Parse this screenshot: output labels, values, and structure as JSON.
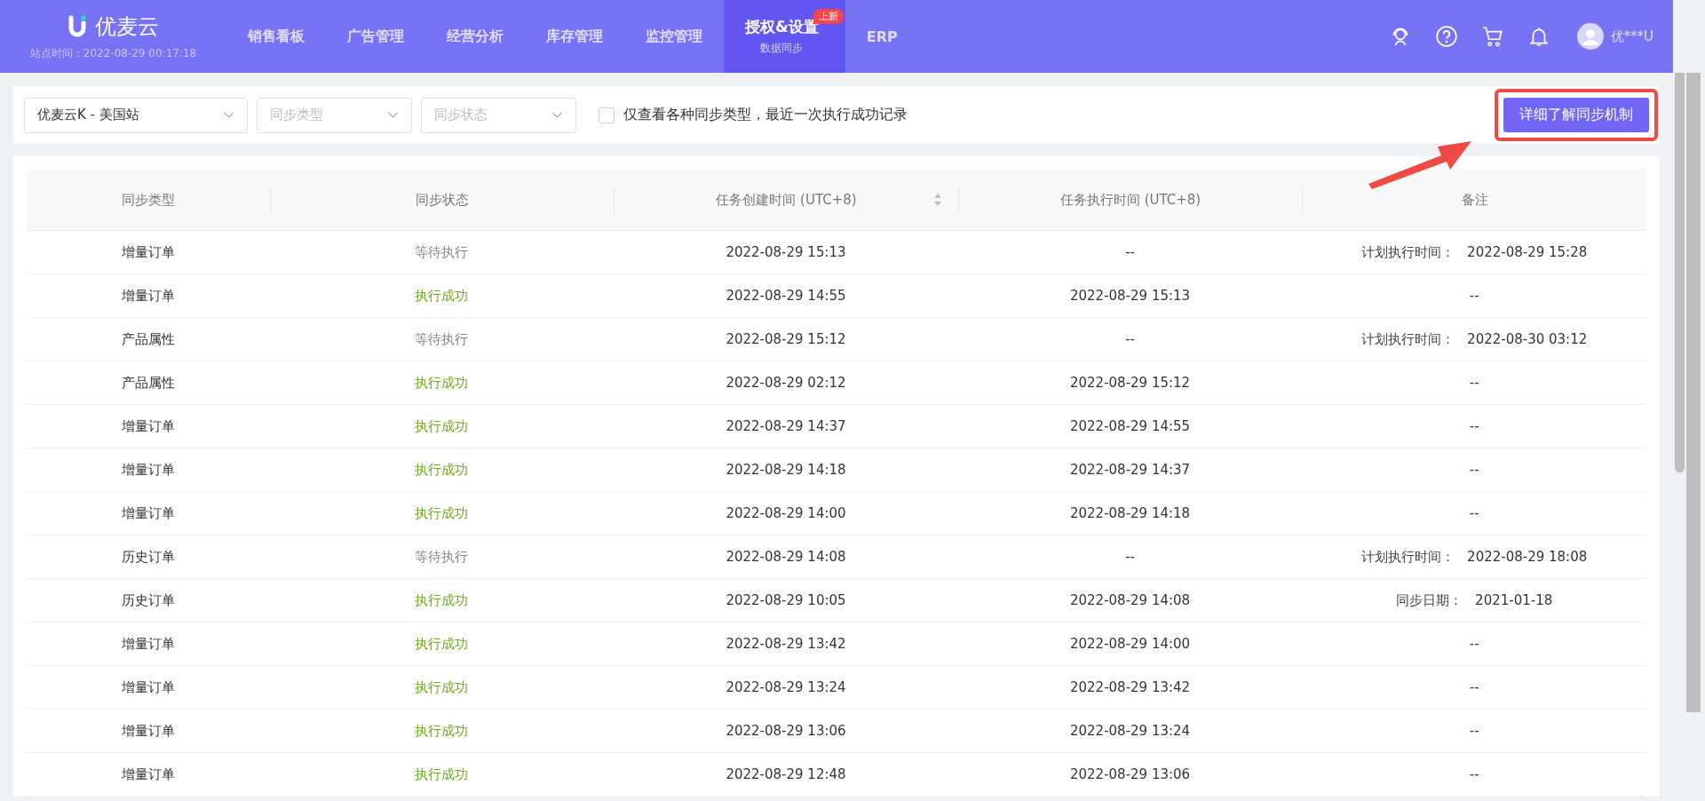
{
  "header": {
    "brand": "优麦云",
    "site_time": "站点时间：2022-08-29 00:17:18",
    "nav": [
      {
        "label": "销售看板",
        "selected": false
      },
      {
        "label": "广告管理",
        "selected": false
      },
      {
        "label": "经营分析",
        "selected": false
      },
      {
        "label": "库存管理",
        "selected": false
      },
      {
        "label": "监控管理",
        "selected": false
      },
      {
        "label": "授权&设置",
        "selected": true,
        "subtitle": "数据同步",
        "badge": "上新"
      },
      {
        "label": "ERP",
        "selected": false
      }
    ],
    "user": "优***U"
  },
  "filters": {
    "shop": "优麦云K - 美国站",
    "sync_type": {
      "placeholder": "同步类型"
    },
    "sync_status": {
      "placeholder": "同步状态"
    },
    "latest_only": {
      "label": "仅查看各种同步类型，最近一次执行成功记录",
      "checked": false
    },
    "learn_button": "详细了解同步机制"
  },
  "table": {
    "columns": [
      "同步类型",
      "同步状态",
      "任务创建时间 (UTC+8)",
      "任务执行时间 (UTC+8)",
      "备注"
    ],
    "rows": [
      {
        "type": "增量订单",
        "status": "等待执行",
        "kind": "waiting",
        "created": "2022-08-29 15:13",
        "executed": "--",
        "note_label": "计划执行时间：",
        "note": "2022-08-29 15:28"
      },
      {
        "type": "增量订单",
        "status": "执行成功",
        "kind": "success",
        "created": "2022-08-29 14:55",
        "executed": "2022-08-29 15:13",
        "note": "--"
      },
      {
        "type": "产品属性",
        "status": "等待执行",
        "kind": "waiting",
        "created": "2022-08-29 15:12",
        "executed": "--",
        "note_label": "计划执行时间：",
        "note": "2022-08-30 03:12"
      },
      {
        "type": "产品属性",
        "status": "执行成功",
        "kind": "success",
        "created": "2022-08-29 02:12",
        "executed": "2022-08-29 15:12",
        "note": "--"
      },
      {
        "type": "增量订单",
        "status": "执行成功",
        "kind": "success",
        "created": "2022-08-29 14:37",
        "executed": "2022-08-29 14:55",
        "note": "--"
      },
      {
        "type": "增量订单",
        "status": "执行成功",
        "kind": "success",
        "created": "2022-08-29 14:18",
        "executed": "2022-08-29 14:37",
        "note": "--"
      },
      {
        "type": "增量订单",
        "status": "执行成功",
        "kind": "success",
        "created": "2022-08-29 14:00",
        "executed": "2022-08-29 14:18",
        "note": "--"
      },
      {
        "type": "历史订单",
        "status": "等待执行",
        "kind": "waiting",
        "created": "2022-08-29 14:08",
        "executed": "--",
        "note_label": "计划执行时间：",
        "note": "2022-08-29 18:08"
      },
      {
        "type": "历史订单",
        "status": "执行成功",
        "kind": "success",
        "created": "2022-08-29 10:05",
        "executed": "2022-08-29 14:08",
        "note_label": "同步日期：",
        "note": "2021-01-18"
      },
      {
        "type": "增量订单",
        "status": "执行成功",
        "kind": "success",
        "created": "2022-08-29 13:42",
        "executed": "2022-08-29 14:00",
        "note": "--"
      },
      {
        "type": "增量订单",
        "status": "执行成功",
        "kind": "success",
        "created": "2022-08-29 13:24",
        "executed": "2022-08-29 13:42",
        "note": "--"
      },
      {
        "type": "增量订单",
        "status": "执行成功",
        "kind": "success",
        "created": "2022-08-29 13:06",
        "executed": "2022-08-29 13:24",
        "note": "--"
      },
      {
        "type": "增量订单",
        "status": "执行成功",
        "kind": "success",
        "created": "2022-08-29 12:48",
        "executed": "2022-08-29 13:06",
        "note": "--"
      }
    ]
  }
}
